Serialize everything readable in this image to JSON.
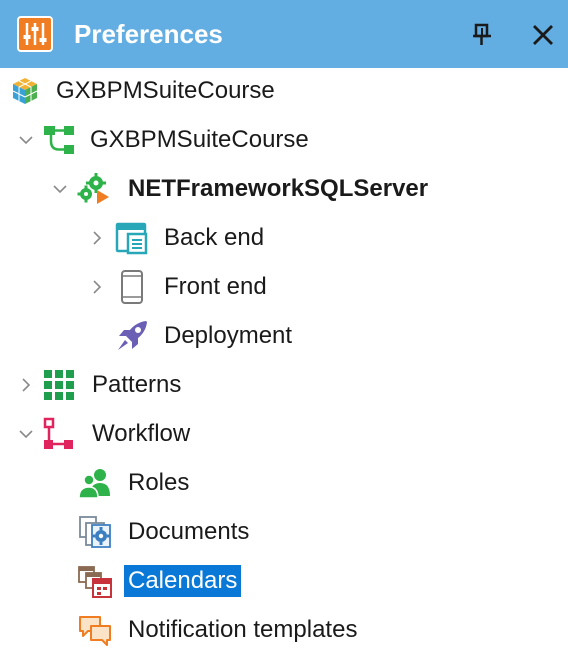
{
  "titlebar": {
    "title": "Preferences",
    "title_icon": "preferences-sliders-icon",
    "pin_icon": "pin-icon",
    "close_icon": "close-icon"
  },
  "tree": {
    "root": {
      "label": "GXBPMSuiteCourse",
      "icon": "knowledge-base-icon"
    },
    "version": {
      "label": "GXBPMSuiteCourse",
      "icon": "version-tree-icon",
      "expanded": true
    },
    "environment": {
      "label": "NETFrameworkSQLServer",
      "icon": "environment-gears-icon",
      "expanded": true,
      "active": true
    },
    "backend": {
      "label": "Back end",
      "icon": "backend-window-icon",
      "expanded": false
    },
    "frontend": {
      "label": "Front end",
      "icon": "mobile-device-icon",
      "expanded": false
    },
    "deployment": {
      "label": "Deployment",
      "icon": "rocket-icon"
    },
    "patterns": {
      "label": "Patterns",
      "icon": "patterns-grid-icon",
      "expanded": false
    },
    "workflow": {
      "label": "Workflow",
      "icon": "workflow-diagram-icon",
      "expanded": true
    },
    "roles": {
      "label": "Roles",
      "icon": "roles-users-icon"
    },
    "documents": {
      "label": "Documents",
      "icon": "documents-icon"
    },
    "calendars": {
      "label": "Calendars",
      "icon": "calendars-icon",
      "selected": true
    },
    "notifications": {
      "label": "Notification templates",
      "icon": "speech-bubbles-icon"
    }
  },
  "colors": {
    "titlebar_bg": "#62aee2",
    "selection_bg": "#0a78d7",
    "chevron": "#8a8a8a"
  }
}
